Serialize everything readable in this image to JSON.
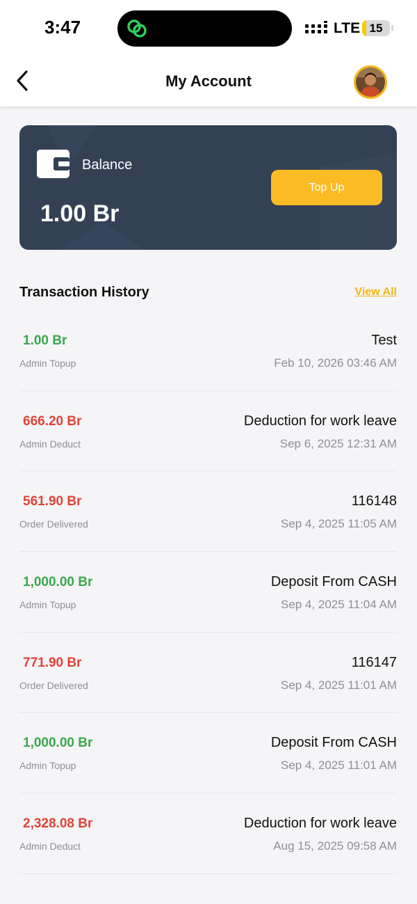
{
  "status_bar": {
    "time": "3:47",
    "network": "LTE",
    "battery": "15",
    "battery_level": 0.15
  },
  "header": {
    "title": "My Account",
    "back_icon": "chevron-left-icon",
    "avatar_icon": "user-avatar"
  },
  "balance_card": {
    "label": "Balance",
    "amount": "1.00 Br",
    "topup_label": "Top Up",
    "wallet_icon": "wallet-icon"
  },
  "transactions": {
    "title": "Transaction History",
    "view_all_label": "View All",
    "items": [
      {
        "amount": "1.00 Br",
        "kind": "credit",
        "type": "Admin Topup",
        "description": "Test",
        "date": "Feb 10, 2026 03:46 AM"
      },
      {
        "amount": "666.20 Br",
        "kind": "debit",
        "type": "Admin Deduct",
        "description": "Deduction for work leave",
        "date": "Sep 6, 2025 12:31 AM"
      },
      {
        "amount": "561.90 Br",
        "kind": "debit",
        "type": "Order Delivered",
        "description": "116148",
        "date": "Sep 4, 2025 11:05 AM"
      },
      {
        "amount": "1,000.00 Br",
        "kind": "credit",
        "type": "Admin Topup",
        "description": "Deposit From CASH",
        "date": "Sep 4, 2025 11:04 AM"
      },
      {
        "amount": "771.90 Br",
        "kind": "debit",
        "type": "Order Delivered",
        "description": "116147",
        "date": "Sep 4, 2025 11:01 AM"
      },
      {
        "amount": "1,000.00 Br",
        "kind": "credit",
        "type": "Admin Topup",
        "description": "Deposit From CASH",
        "date": "Sep 4, 2025 11:01 AM"
      },
      {
        "amount": "2,328.08 Br",
        "kind": "debit",
        "type": "Admin Deduct",
        "description": "Deduction for work leave",
        "date": "Aug 15, 2025 09:58 AM"
      }
    ]
  },
  "colors": {
    "accent": "#fbbb25",
    "card_bg": "#344155",
    "credit": "#3aa84a",
    "debit": "#e04337",
    "muted": "#8f8f94"
  }
}
